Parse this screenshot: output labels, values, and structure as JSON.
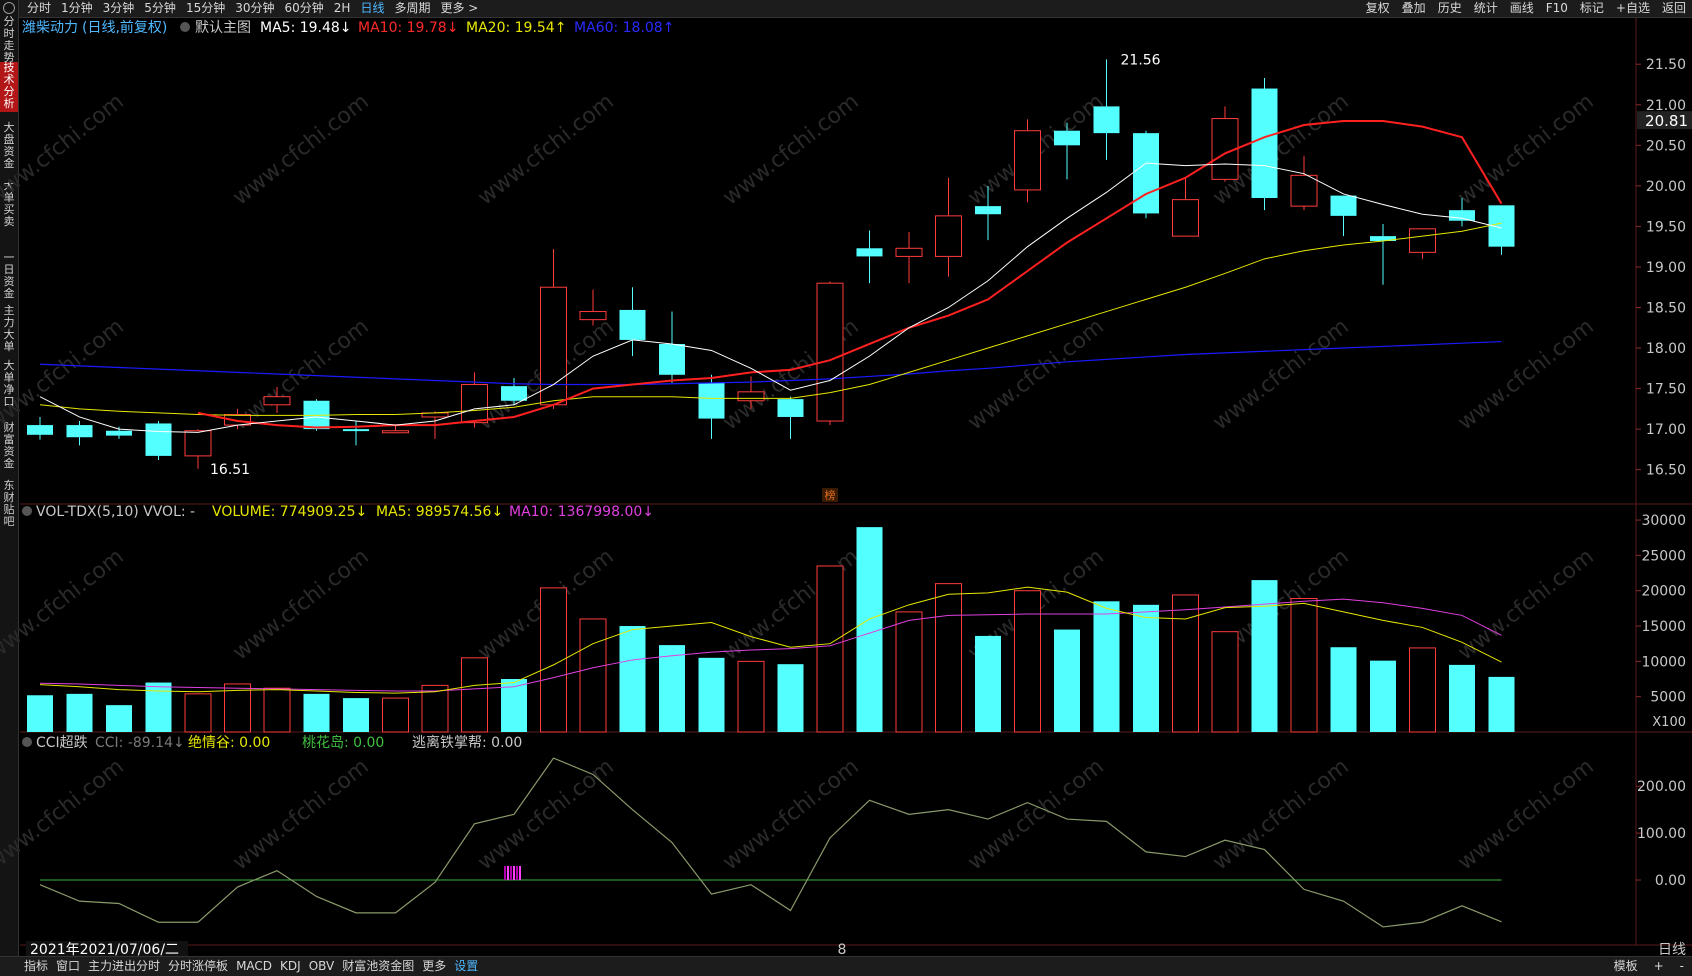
{
  "toolbar": {
    "periods": [
      "分时",
      "1分钟",
      "3分钟",
      "5分钟",
      "15分钟",
      "30分钟",
      "60分钟",
      "2H",
      "日线",
      "多周期",
      "更多 >"
    ],
    "active_period": "日线",
    "right_items": [
      "复权",
      "叠加",
      "历史",
      "统计",
      "画线",
      "F10",
      "标记",
      "+自选",
      "返回"
    ]
  },
  "sidebar": {
    "items": [
      "分时走势",
      "技术分析",
      "大盘资金",
      "大单买卖",
      "一日资金",
      "主力大单",
      "大单净口",
      "财富资金",
      "东财贴吧"
    ],
    "active_item": "技术分析"
  },
  "price_panel": {
    "stock": "潍柴动力",
    "mode": "(日线,前复权)",
    "template": "默认主图",
    "ma": [
      {
        "label": "MA5: 19.48",
        "arrow": "↓",
        "color": "#ffffff"
      },
      {
        "label": "MA10: 19.78",
        "arrow": "↓",
        "color": "#ff2a2a"
      },
      {
        "label": "MA20: 19.54",
        "arrow": "↑",
        "color": "#e6e600"
      },
      {
        "label": "MA60: 18.08",
        "arrow": "↑",
        "color": "#2a2aff"
      }
    ],
    "current_price": "20.81",
    "high_label": "21.56",
    "low_label": "16.51",
    "event_marker": "榜"
  },
  "volume_panel": {
    "title": "VOL-TDX(5,10) VVOL: -",
    "volume_label": "VOLUME: 774909.25",
    "volume_arrow": "↓",
    "ma5_label": "MA5: 989574.56",
    "ma5_arrow": "↓",
    "ma10_label": "MA10: 1367998.00",
    "ma10_arrow": "↓",
    "unit": "X100"
  },
  "cci_panel": {
    "title": "CCI超跌",
    "cci_label": "CCI: -89.14",
    "cci_arrow": "↓",
    "jqg_label": "绝情谷: 0.00",
    "thd_label": "桃花岛: 0.00",
    "tlt_label": "逃离铁掌帮: 0.00"
  },
  "x_axis": {
    "date_label": "2021年2021/07/06/二",
    "month_label": "8"
  },
  "bottom_tabs": [
    "指标",
    "窗口",
    "主力进出分时",
    "分时涨停板",
    "MACD",
    "KDJ",
    "OBV",
    "财富池资金图",
    "更多",
    "设置"
  ],
  "bottom_right": [
    "模板",
    "+",
    "-"
  ],
  "period_label": "日线",
  "watermark": "www.cfchi.com",
  "colors": {
    "up": "#ff3c3c",
    "down": "#54ffff",
    "ma5": "#ffffff",
    "ma10": "#ff2020",
    "ma20": "#e6e600",
    "ma60": "#1a1aff",
    "vol_ma5": "#e6e600",
    "vol_ma10": "#e040e0",
    "cci": "#8a9a6a",
    "zero_line": "#3cb83c"
  },
  "chart_data": {
    "type": "candlestick",
    "candles": [
      {
        "open": 17.05,
        "close": 16.93,
        "high": 17.15,
        "low": 16.87
      },
      {
        "open": 17.05,
        "close": 16.9,
        "high": 17.1,
        "low": 16.8
      },
      {
        "open": 16.98,
        "close": 16.92,
        "high": 17.03,
        "low": 16.88
      },
      {
        "open": 17.07,
        "close": 16.67,
        "high": 17.1,
        "low": 16.62
      },
      {
        "open": 16.67,
        "close": 16.98,
        "high": 17.0,
        "low": 16.51
      },
      {
        "open": 17.05,
        "close": 17.18,
        "high": 17.25,
        "low": 17.0
      },
      {
        "open": 17.3,
        "close": 17.4,
        "high": 17.52,
        "low": 17.2
      },
      {
        "open": 17.35,
        "close": 17.0,
        "high": 17.37,
        "low": 16.98
      },
      {
        "open": 17.0,
        "close": 16.98,
        "high": 17.1,
        "low": 16.8
      },
      {
        "open": 16.97,
        "close": 16.98,
        "high": 17.05,
        "low": 16.95
      },
      {
        "open": 17.15,
        "close": 17.2,
        "high": 17.22,
        "low": 16.88
      },
      {
        "open": 17.08,
        "close": 17.55,
        "high": 17.7,
        "low": 17.02
      },
      {
        "open": 17.53,
        "close": 17.35,
        "high": 17.63,
        "low": 17.3
      },
      {
        "open": 17.3,
        "close": 18.75,
        "high": 19.22,
        "low": 17.25
      },
      {
        "open": 18.35,
        "close": 18.45,
        "high": 18.72,
        "low": 18.28
      },
      {
        "open": 18.47,
        "close": 18.1,
        "high": 18.75,
        "low": 17.9
      },
      {
        "open": 18.05,
        "close": 17.67,
        "high": 18.45,
        "low": 17.57
      },
      {
        "open": 17.57,
        "close": 17.13,
        "high": 17.67,
        "low": 16.88
      },
      {
        "open": 17.35,
        "close": 17.46,
        "high": 17.65,
        "low": 17.25
      },
      {
        "open": 17.37,
        "close": 17.15,
        "high": 17.4,
        "low": 16.88
      },
      {
        "open": 17.1,
        "close": 18.8,
        "high": 18.82,
        "low": 17.05
      },
      {
        "open": 19.23,
        "close": 19.13,
        "high": 19.45,
        "low": 18.8
      },
      {
        "open": 19.13,
        "close": 19.23,
        "high": 19.43,
        "low": 18.8
      },
      {
        "open": 19.13,
        "close": 19.63,
        "high": 20.1,
        "low": 18.88
      },
      {
        "open": 19.75,
        "close": 19.65,
        "high": 20.0,
        "low": 19.33
      },
      {
        "open": 19.95,
        "close": 20.68,
        "high": 20.82,
        "low": 19.8
      },
      {
        "open": 20.68,
        "close": 20.5,
        "high": 20.78,
        "low": 20.08
      },
      {
        "open": 20.98,
        "close": 20.65,
        "high": 21.56,
        "low": 20.32
      },
      {
        "open": 20.65,
        "close": 19.66,
        "high": 20.68,
        "low": 19.6
      },
      {
        "open": 19.38,
        "close": 19.83,
        "high": 20.1,
        "low": 19.38
      },
      {
        "open": 20.08,
        "close": 20.83,
        "high": 20.98,
        "low": 20.05
      },
      {
        "open": 21.2,
        "close": 19.85,
        "high": 21.33,
        "low": 19.7
      },
      {
        "open": 19.75,
        "close": 20.13,
        "high": 20.37,
        "low": 19.7
      },
      {
        "open": 19.88,
        "close": 19.63,
        "high": 19.88,
        "low": 19.38
      },
      {
        "open": 19.38,
        "close": 19.32,
        "high": 19.53,
        "low": 18.78
      },
      {
        "open": 19.18,
        "close": 19.47,
        "high": 19.47,
        "low": 19.1
      },
      {
        "open": 19.7,
        "close": 19.57,
        "high": 19.85,
        "low": 19.5
      },
      {
        "open": 19.76,
        "close": 19.25,
        "high": 19.76,
        "low": 19.15
      }
    ],
    "ma5": [
      17.4,
      17.15,
      17.0,
      16.97,
      16.96,
      17.05,
      17.1,
      17.15,
      17.1,
      17.05,
      17.1,
      17.25,
      17.3,
      17.55,
      17.9,
      18.1,
      18.05,
      17.97,
      17.75,
      17.48,
      17.6,
      17.9,
      18.25,
      18.5,
      18.83,
      19.25,
      19.6,
      19.92,
      20.28,
      20.25,
      20.27,
      20.25,
      20.15,
      19.9,
      19.77,
      19.65,
      19.6,
      19.48
    ],
    "ma10": [
      null,
      null,
      null,
      null,
      17.2,
      17.1,
      17.05,
      17.02,
      17.03,
      17.05,
      17.05,
      17.1,
      17.15,
      17.3,
      17.5,
      17.55,
      17.6,
      17.63,
      17.7,
      17.73,
      17.85,
      18.05,
      18.25,
      18.4,
      18.6,
      18.95,
      19.3,
      19.6,
      19.9,
      20.1,
      20.4,
      20.6,
      20.75,
      20.8,
      20.8,
      20.73,
      20.6,
      19.78
    ],
    "ma20": [
      17.3,
      17.25,
      17.22,
      17.2,
      17.18,
      17.17,
      17.17,
      17.17,
      17.18,
      17.18,
      17.2,
      17.23,
      17.27,
      17.35,
      17.4,
      17.4,
      17.4,
      17.38,
      17.38,
      17.38,
      17.45,
      17.55,
      17.7,
      17.85,
      18.0,
      18.15,
      18.3,
      18.45,
      18.6,
      18.75,
      18.92,
      19.1,
      19.2,
      19.27,
      19.32,
      19.38,
      19.44,
      19.54
    ],
    "ma60": [
      17.8,
      17.78,
      17.76,
      17.74,
      17.72,
      17.7,
      17.68,
      17.66,
      17.64,
      17.62,
      17.6,
      17.58,
      17.56,
      17.55,
      17.55,
      17.55,
      17.56,
      17.57,
      17.58,
      17.6,
      17.62,
      17.65,
      17.68,
      17.72,
      17.75,
      17.79,
      17.83,
      17.86,
      17.89,
      17.92,
      17.94,
      17.96,
      17.98,
      18.0,
      18.02,
      18.04,
      18.06,
      18.08
    ],
    "volume": [
      5200,
      5400,
      3800,
      7000,
      5400,
      6800,
      6200,
      5400,
      4800,
      4800,
      6600,
      10500,
      7500,
      20400,
      16000,
      15000,
      12300,
      10500,
      10000,
      9600,
      23500,
      29000,
      17000,
      21000,
      13600,
      20000,
      14500,
      18500,
      18000,
      19400,
      14200,
      21500,
      18900,
      12000,
      10100,
      11900,
      9500,
      7800
    ],
    "vol_ma5": [
      6700,
      6400,
      6000,
      5800,
      5700,
      5900,
      6000,
      5800,
      5600,
      5500,
      5700,
      6600,
      7000,
      9500,
      12500,
      14500,
      15000,
      15500,
      13500,
      12000,
      12500,
      16000,
      18000,
      19500,
      19700,
      20500,
      19800,
      17500,
      16200,
      16000,
      17600,
      17800,
      18200,
      17000,
      15800,
      14800,
      12700,
      9900
    ],
    "vol_ma10": [
      6900,
      6800,
      6600,
      6400,
      6300,
      6200,
      6100,
      6000,
      5900,
      5800,
      5800,
      6100,
      6400,
      7700,
      9100,
      10200,
      10800,
      11300,
      11600,
      11800,
      12200,
      14000,
      15800,
      16500,
      16600,
      16700,
      16700,
      16700,
      17000,
      17300,
      17700,
      18100,
      18500,
      18800,
      18300,
      17500,
      16500,
      13680
    ],
    "cci": [
      -10,
      -45,
      -50,
      -90,
      -90,
      -15,
      20,
      -35,
      -70,
      -70,
      -5,
      120,
      140,
      260,
      225,
      150,
      80,
      -30,
      -10,
      -65,
      90,
      170,
      140,
      150,
      130,
      165,
      130,
      125,
      60,
      50,
      85,
      65,
      -20,
      -45,
      -100,
      -90,
      -55,
      -89.14
    ]
  }
}
